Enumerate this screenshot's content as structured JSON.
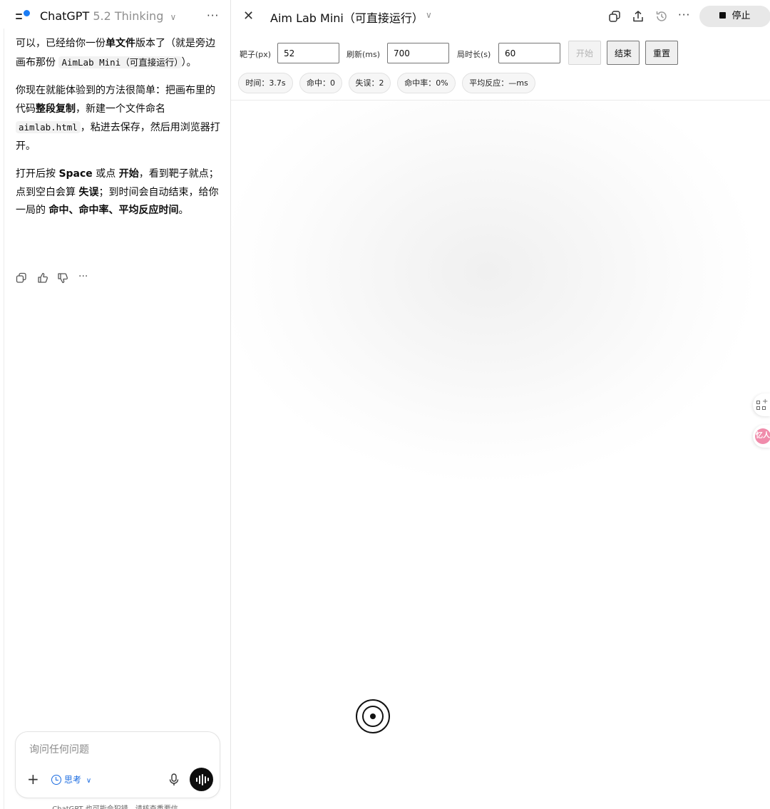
{
  "chat": {
    "brand": "ChatGPT",
    "model_version": "5.2 Thinking",
    "message": {
      "p1_a": "可以，已经给你一份",
      "p1_b": "单文件",
      "p1_c": "版本了（就是旁边画布那份",
      "p1_code": "AimLab Mini（可直接运行）",
      "p1_d": "）。",
      "p2_a": "你现在就能体验到的方法很简单：把画布里的代码",
      "p2_b": "整段复制",
      "p2_c": "，新建一个文件命名",
      "p2_code": "aimlab.html",
      "p2_d": "，粘进去保存，然后用浏览器打开。",
      "p3_a": "打开后按",
      "p3_b": "Space",
      "p3_c": "或点",
      "p3_d": "开始",
      "p3_e": "，看到靶子就点；点到空白会算",
      "p3_f": "失误",
      "p3_g": "；到时间会自动结束，给你一局的",
      "p3_h": "命中、命中率、平均反应时间",
      "p3_i": "。"
    },
    "composer_placeholder": "询问任何问题",
    "think_label": "思考",
    "disclaimer": "ChatGPT 也可能会犯错。请核查重要信"
  },
  "canvas": {
    "title": "Aim Lab Mini（可直接运行）",
    "stop_label": "停止",
    "controls": {
      "target_label": "靶子(px)",
      "target_value": "52",
      "refresh_label": "刷新(ms)",
      "refresh_value": "700",
      "duration_label": "局时长(s)",
      "duration_value": "60",
      "start_label": "开始",
      "end_label": "结束",
      "reset_label": "重置"
    },
    "stats": {
      "time": "时间：3.7s",
      "hits": "命中：0",
      "misses": "失误：2",
      "hit_rate": "命中率：0%",
      "avg_reaction": "平均反应：—ms"
    },
    "side_badge": "忆人"
  }
}
